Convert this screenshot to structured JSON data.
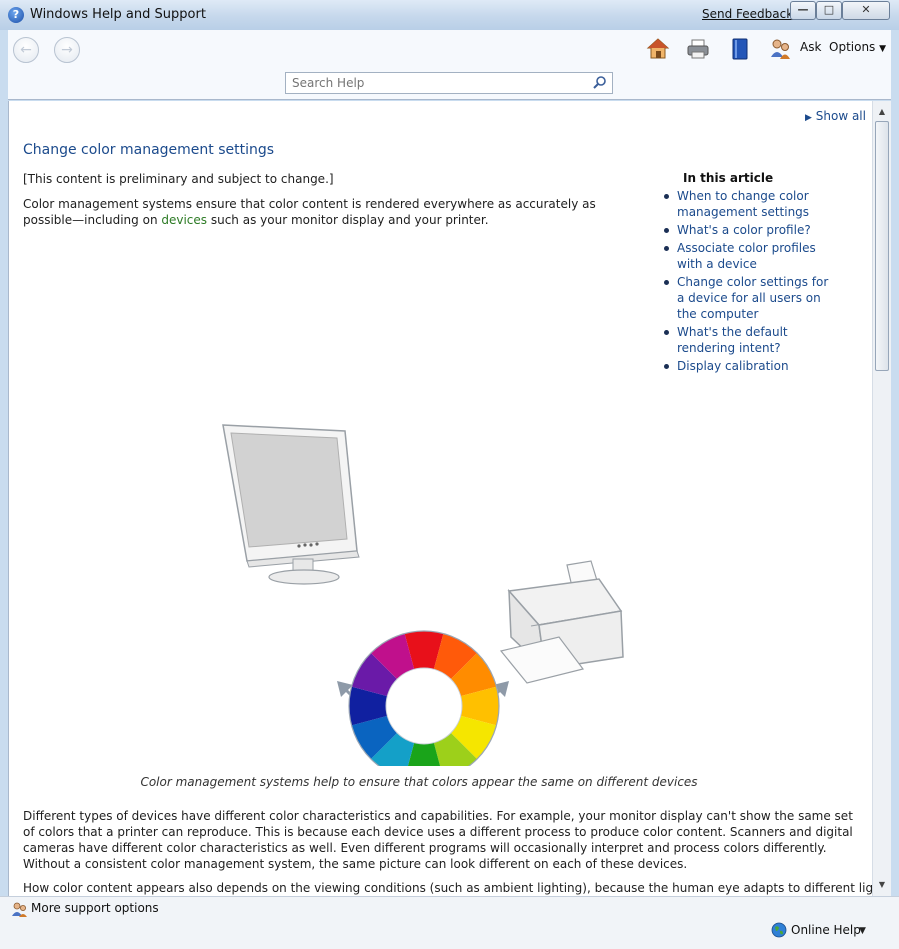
{
  "window": {
    "title": "Windows Help and Support",
    "send_feedback": "Send Feedback",
    "buttons": {
      "minimize": "—",
      "maximize": "□",
      "close": "✕"
    }
  },
  "toolbar": {
    "back_label": "←",
    "forward_label": "→",
    "ask_label": "Ask",
    "options_label": "Options",
    "icons": [
      "home-icon",
      "print-icon",
      "browse-help-icon",
      "ask-icon"
    ],
    "search_placeholder": "Search Help"
  },
  "article": {
    "show_all": "Show all",
    "title": "Change color management settings",
    "preliminary_note": "[This content is preliminary and subject to change.]",
    "intro_before": "Color management systems ensure that color content is rendered everywhere as accurately as possible—including on ",
    "intro_link": "devices",
    "intro_after": " such as your monitor display and your printer.",
    "caption": "Color management systems help to ensure that colors appear the same on different devices",
    "paragraph1": "Different types of devices have different color characteristics and capabilities. For example, your monitor display can't show the same set of colors that a printer can reproduce. This is because each device uses a different process to produce color content. Scanners and digital cameras have different color characteristics as well. Even different programs will occasionally interpret and process colors differently. Without a consistent color management system, the same picture can look different on each of these devices.",
    "paragraph2": "How color content appears also depends on the viewing conditions (such as ambient lighting), because the human eye adapts to different lighting conditions,"
  },
  "toc": {
    "title": "In this article",
    "items": [
      "When to change color management settings",
      "What's a color profile?",
      "Associate color profiles with a device",
      "Change color settings for a device for all users on the computer",
      "What's the default rendering intent?",
      "Display calibration"
    ]
  },
  "footer": {
    "more_support": "More support options",
    "online_help": "Online Help"
  },
  "colors": {
    "link_blue": "#1b4a8c",
    "link_green": "#2c7a24",
    "wheel": [
      "#e8101a",
      "#ff5a0a",
      "#ff8c00",
      "#ffc000",
      "#f5e600",
      "#9dd01a",
      "#1aa41a",
      "#14a0c8",
      "#0a64c0",
      "#1020a0",
      "#6a1aa8",
      "#c0108c"
    ]
  }
}
